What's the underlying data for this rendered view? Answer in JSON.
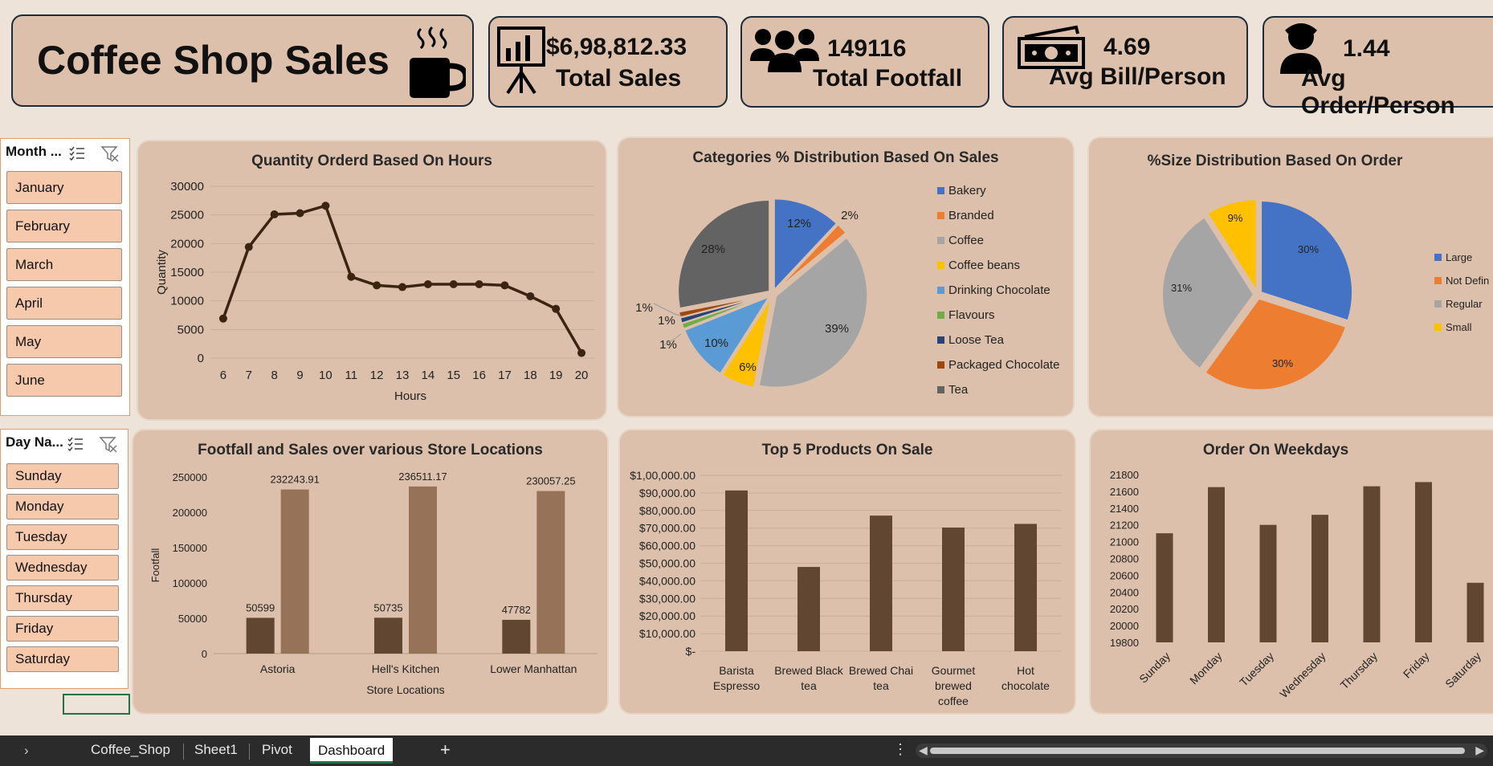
{
  "header": {
    "title": "Coffee Shop Sales"
  },
  "kpis": [
    {
      "value": "$6,98,812.33",
      "label": "Total Sales",
      "icon": "presentation-chart-icon"
    },
    {
      "value": "149116",
      "label": "Total Footfall",
      "icon": "people-group-icon"
    },
    {
      "value": "4.69",
      "label": "Avg Bill/Person",
      "icon": "money-bill-icon"
    },
    {
      "value": "1.44",
      "label": "Avg Order/Person",
      "icon": "person-icon"
    }
  ],
  "slicers": {
    "month": {
      "title": "Month ...",
      "items": [
        "January",
        "February",
        "March",
        "April",
        "May",
        "June"
      ]
    },
    "day": {
      "title": "Day Na...",
      "items": [
        "Sunday",
        "Monday",
        "Tuesday",
        "Wednesday",
        "Thursday",
        "Friday",
        "Saturday"
      ]
    }
  },
  "tabs": {
    "items": [
      "Coffee_Shop",
      "Sheet1",
      "Pivot",
      "Dashboard"
    ],
    "active": "Dashboard",
    "add": "+"
  },
  "colors": {
    "brown_dark": "#3b2412",
    "bar_dark": "#614632",
    "bar_light": "#967258",
    "panel": "#dcc0ab",
    "bg": "#ede3d8"
  },
  "chart_data": [
    {
      "id": "hours",
      "type": "line",
      "title": "Quantity Orderd Based On Hours",
      "xlabel": "Hours",
      "ylabel": "Quantity",
      "x": [
        "6",
        "7",
        "8",
        "9",
        "10",
        "11",
        "12",
        "13",
        "14",
        "15",
        "16",
        "17",
        "18",
        "19",
        "20"
      ],
      "values": [
        6900,
        19400,
        25100,
        25300,
        26600,
        14200,
        12700,
        12400,
        12900,
        12900,
        12900,
        12700,
        10800,
        8600,
        900
      ],
      "ylim": [
        0,
        30000
      ],
      "yticks": [
        "0",
        "5000",
        "10000",
        "15000",
        "20000",
        "25000",
        "30000"
      ],
      "grid": true
    },
    {
      "id": "categories",
      "type": "pie",
      "title": "Categories % Distribution Based On Sales",
      "labels": [
        "Bakery",
        "Branded",
        "Coffee",
        "Coffee beans",
        "Drinking Chocolate",
        "Flavours",
        "Loose Tea",
        "Packaged Chocolate",
        "Tea"
      ],
      "values": [
        12,
        2,
        39,
        6,
        10,
        1,
        1,
        1,
        28
      ],
      "data_labels": [
        "12%",
        "2%",
        "39%",
        "6%",
        "10%",
        "1%",
        "1%",
        "1%",
        "28%"
      ],
      "colors": [
        "#4472c4",
        "#ed7d31",
        "#a5a5a5",
        "#ffc000",
        "#5b9bd5",
        "#70ad47",
        "#264478",
        "#9e480e",
        "#636363"
      ],
      "legend": "right"
    },
    {
      "id": "sizes",
      "type": "pie",
      "title": "%Size Distribution Based On Order",
      "labels": [
        "Large",
        "Not Defin",
        "Regular",
        "Small"
      ],
      "values": [
        30,
        30,
        31,
        9
      ],
      "data_labels": [
        "30%",
        "30%",
        "31%",
        "9%"
      ],
      "colors": [
        "#4472c4",
        "#ed7d31",
        "#a5a5a5",
        "#ffc000"
      ],
      "legend": "right"
    },
    {
      "id": "locations",
      "type": "bar",
      "title": "Footfall and Sales over various Store Locations",
      "xlabel": "Store Locations",
      "ylabel": "Footfall",
      "categories": [
        "Astoria",
        "Hell's Kitchen",
        "Lower Manhattan"
      ],
      "series": [
        {
          "values": [
            50599,
            50735,
            47782
          ],
          "labels": [
            "50599",
            "50735",
            "47782"
          ]
        },
        {
          "values": [
            232243.91,
            236511.17,
            230057.25
          ],
          "labels": [
            "232243.91",
            "236511.17",
            "230057.25"
          ]
        }
      ],
      "ylim": [
        0,
        250000
      ],
      "yticks": [
        "0",
        "50000",
        "100000",
        "150000",
        "200000",
        "250000"
      ]
    },
    {
      "id": "products",
      "type": "bar",
      "title": "Top 5 Products On Sale",
      "categories": [
        [
          "Barista",
          "Espresso"
        ],
        [
          "Brewed Black",
          "tea"
        ],
        [
          "Brewed Chai",
          "tea"
        ],
        [
          "Gourmet",
          "brewed",
          "coffee"
        ],
        [
          "Hot",
          "chocolate"
        ]
      ],
      "values": [
        91400,
        47900,
        77100,
        70300,
        72400
      ],
      "ylim": [
        0,
        100000
      ],
      "yticks": [
        "$-",
        "$10,000.00",
        "$20,000.00",
        "$30,000.00",
        "$40,000.00",
        "$50,000.00",
        "$60,000.00",
        "$70,000.00",
        "$80,000.00",
        "$90,000.00",
        "$1,00,000.00"
      ],
      "grid": true
    },
    {
      "id": "weekdays",
      "type": "bar",
      "title": "Order On Weekdays",
      "categories": [
        "Sunday",
        "Monday",
        "Tuesday",
        "Wednesday",
        "Thursday",
        "Friday",
        "Saturday"
      ],
      "values": [
        21100,
        21650,
        21200,
        21320,
        21660,
        21710,
        20510
      ],
      "ylim": [
        19800,
        21800
      ],
      "yticks": [
        "19800",
        "20000",
        "20200",
        "20400",
        "20600",
        "20800",
        "21000",
        "21200",
        "21400",
        "21600",
        "21800"
      ]
    }
  ]
}
